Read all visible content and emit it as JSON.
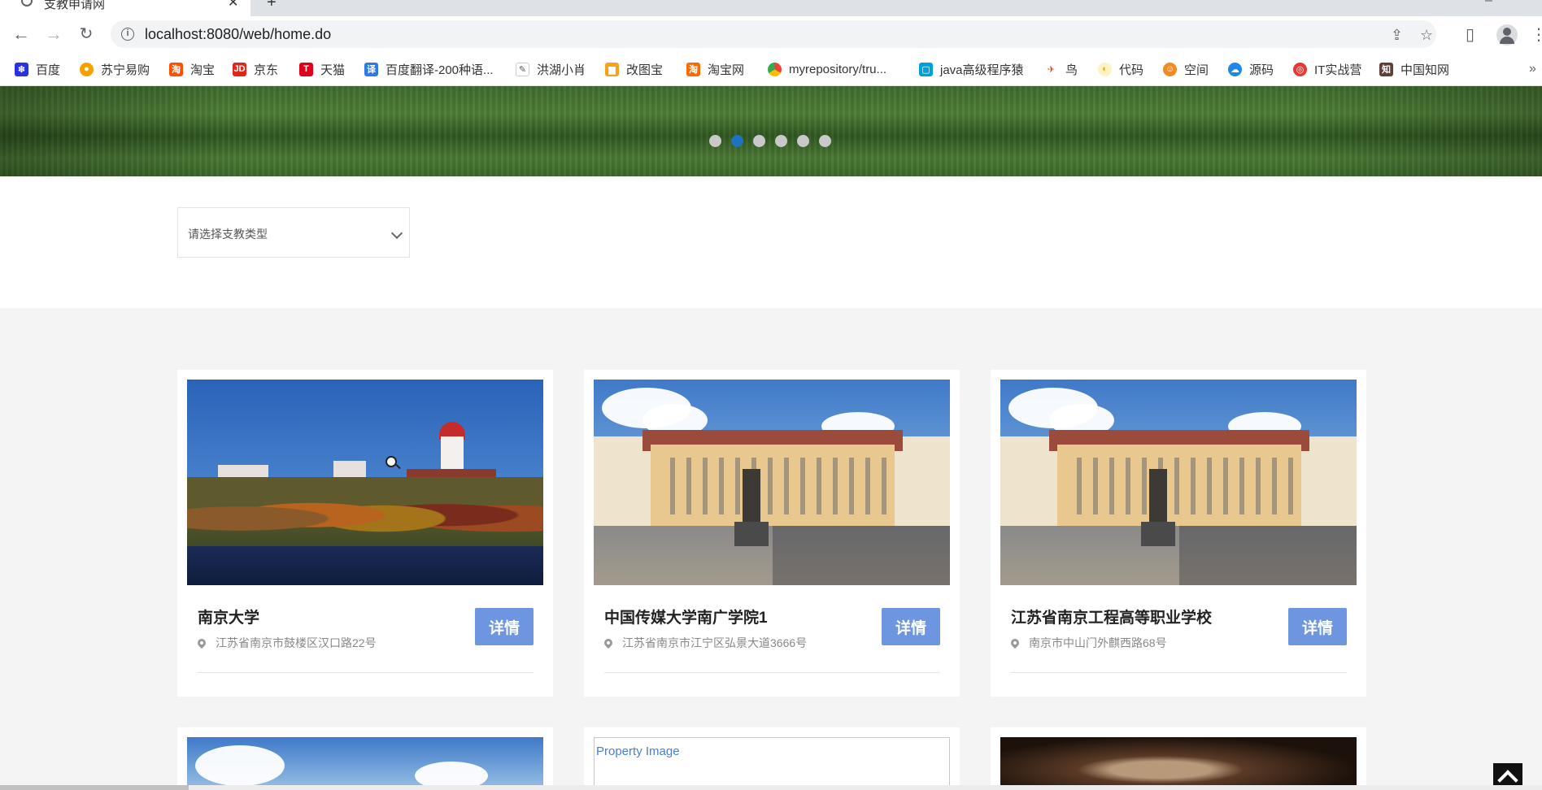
{
  "browser": {
    "tab_title": "支教申请网",
    "url": "localhost:8080/web/home.do",
    "bookmarks": [
      {
        "label": "百度",
        "icon": "baidu-paw-icon",
        "color": "#2932e1"
      },
      {
        "label": "苏宁易购",
        "icon": "suning-lion-icon",
        "color": "#f5a200"
      },
      {
        "label": "淘宝",
        "icon": "taobao-icon",
        "color": "#ff5000"
      },
      {
        "label": "京东",
        "icon": "jd-icon",
        "color": "#e1251b"
      },
      {
        "label": "天猫",
        "icon": "tmall-icon",
        "color": "#e1001a"
      },
      {
        "label": "百度翻译-200种语...",
        "icon": "translate-icon",
        "color": "#2c7be5"
      },
      {
        "label": "洪湖小肖",
        "icon": "pen-icon",
        "color": "#7a7a7a"
      },
      {
        "label": "改图宝",
        "icon": "folder-icon",
        "color": "#f7a21b"
      },
      {
        "label": "淘宝网",
        "icon": "taobao-net-icon",
        "color": "#ff6a00"
      },
      {
        "label": "myrepository/tru...",
        "icon": "chrome-icon",
        "color": "#34a853"
      },
      {
        "label": "java高级程序猿",
        "icon": "bilibili-icon",
        "color": "#00a1d6"
      },
      {
        "label": "鸟",
        "icon": "bird-icon",
        "color": "#e8452c"
      },
      {
        "label": "代码",
        "icon": "circle-icon",
        "color": "#f0c419"
      },
      {
        "label": "空间",
        "icon": "space-icon",
        "color": "#f08a24"
      },
      {
        "label": "源码",
        "icon": "cloud-bird-icon",
        "color": "#1e88e5"
      },
      {
        "label": "IT实战营",
        "icon": "it-camp-icon",
        "color": "#e53935"
      },
      {
        "label": "中国知网",
        "icon": "cnki-icon",
        "color": "#5d4037"
      }
    ]
  },
  "carousel": {
    "slide_count": 6,
    "active_index": 1
  },
  "filter": {
    "placeholder": "请选择支教类型"
  },
  "cards": [
    {
      "name": "南京大学",
      "address": "江苏省南京市鼓楼区汉口路22号",
      "button": "详情",
      "image": "campus-lake-photo"
    },
    {
      "name": "中国传媒大学南广学院1",
      "address": "江苏省南京市江宁区弘景大道3666号",
      "button": "详情",
      "image": "palace-square-photo"
    },
    {
      "name": "江苏省南京工程高等职业学校",
      "address": "南京市中山门外麒西路68号",
      "button": "详情",
      "image": "palace-square-photo"
    }
  ],
  "second_row": [
    {
      "image": "palace-square-photo"
    },
    {
      "image": "broken-image",
      "alt": "Property Image"
    },
    {
      "image": "dark-character-photo"
    }
  ]
}
